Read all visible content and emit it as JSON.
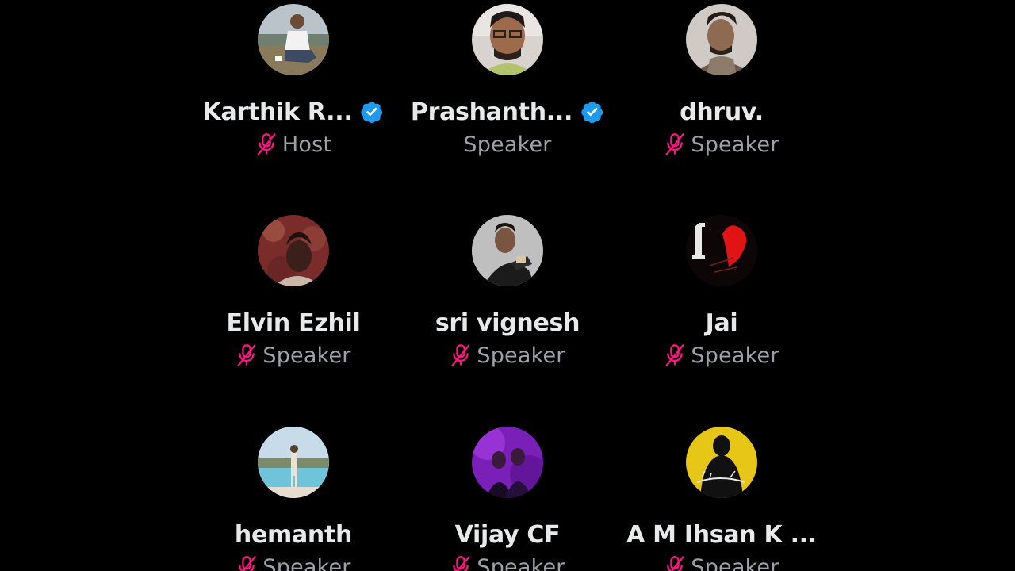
{
  "colors": {
    "background": "#000000",
    "name_text": "#e7e9ea",
    "role_text": "#9ea2a8",
    "muted_mic": "#f91880",
    "verified_badge": "#1d9bf0"
  },
  "participants": [
    {
      "name": "Karthik R...",
      "role": "Host",
      "verified": true,
      "muted": true,
      "avatar_icon": "person-avatar"
    },
    {
      "name": "Prashanth...",
      "role": "Speaker",
      "verified": true,
      "muted": false,
      "avatar_icon": "person-avatar"
    },
    {
      "name": "dhruv.",
      "role": "Speaker",
      "verified": false,
      "muted": true,
      "avatar_icon": "person-avatar"
    },
    {
      "name": "Elvin Ezhil",
      "role": "Speaker",
      "verified": false,
      "muted": true,
      "avatar_icon": "person-avatar"
    },
    {
      "name": "sri vignesh",
      "role": "Speaker",
      "verified": false,
      "muted": true,
      "avatar_icon": "person-avatar"
    },
    {
      "name": "Jai",
      "role": "Speaker",
      "verified": false,
      "muted": true,
      "avatar_icon": "heart-avatar"
    },
    {
      "name": "hemanth",
      "role": "Speaker",
      "verified": false,
      "muted": true,
      "avatar_icon": "person-avatar"
    },
    {
      "name": "Vijay CF",
      "role": "Speaker",
      "verified": false,
      "muted": true,
      "avatar_icon": "person-avatar"
    },
    {
      "name": "A M Ihsan K ...",
      "role": "Speaker",
      "verified": false,
      "muted": true,
      "avatar_icon": "person-avatar"
    }
  ]
}
